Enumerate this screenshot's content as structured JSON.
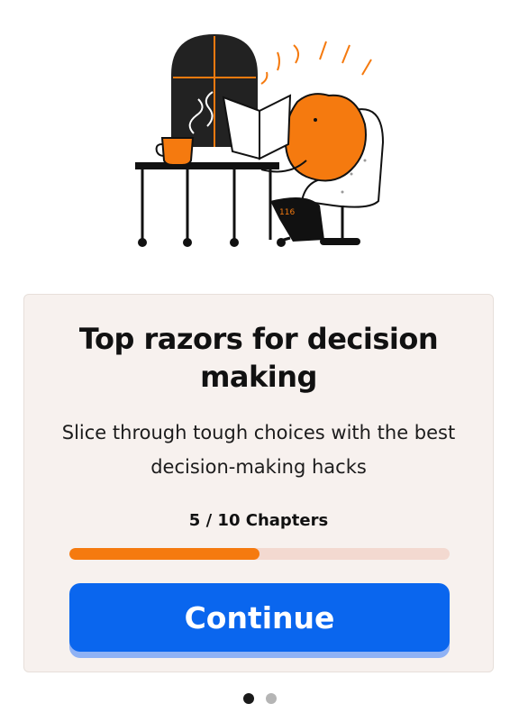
{
  "illustration": {
    "icon": "reading-fox-illustration",
    "page_number": "116"
  },
  "card": {
    "title": "Top razors for decision making",
    "subtitle": "Slice through tough choices with the best decision-making hacks",
    "chapters_label": "5 / 10 Chapters",
    "progress": 0.5,
    "button_label": "Continue"
  },
  "pagination": {
    "pages": 2,
    "active_index": 0
  },
  "colors": {
    "accent_orange": "#f57a0f",
    "primary_blue": "#0a66ee",
    "card_bg": "#f7f1ee",
    "track_bg": "#f3d9d0"
  }
}
